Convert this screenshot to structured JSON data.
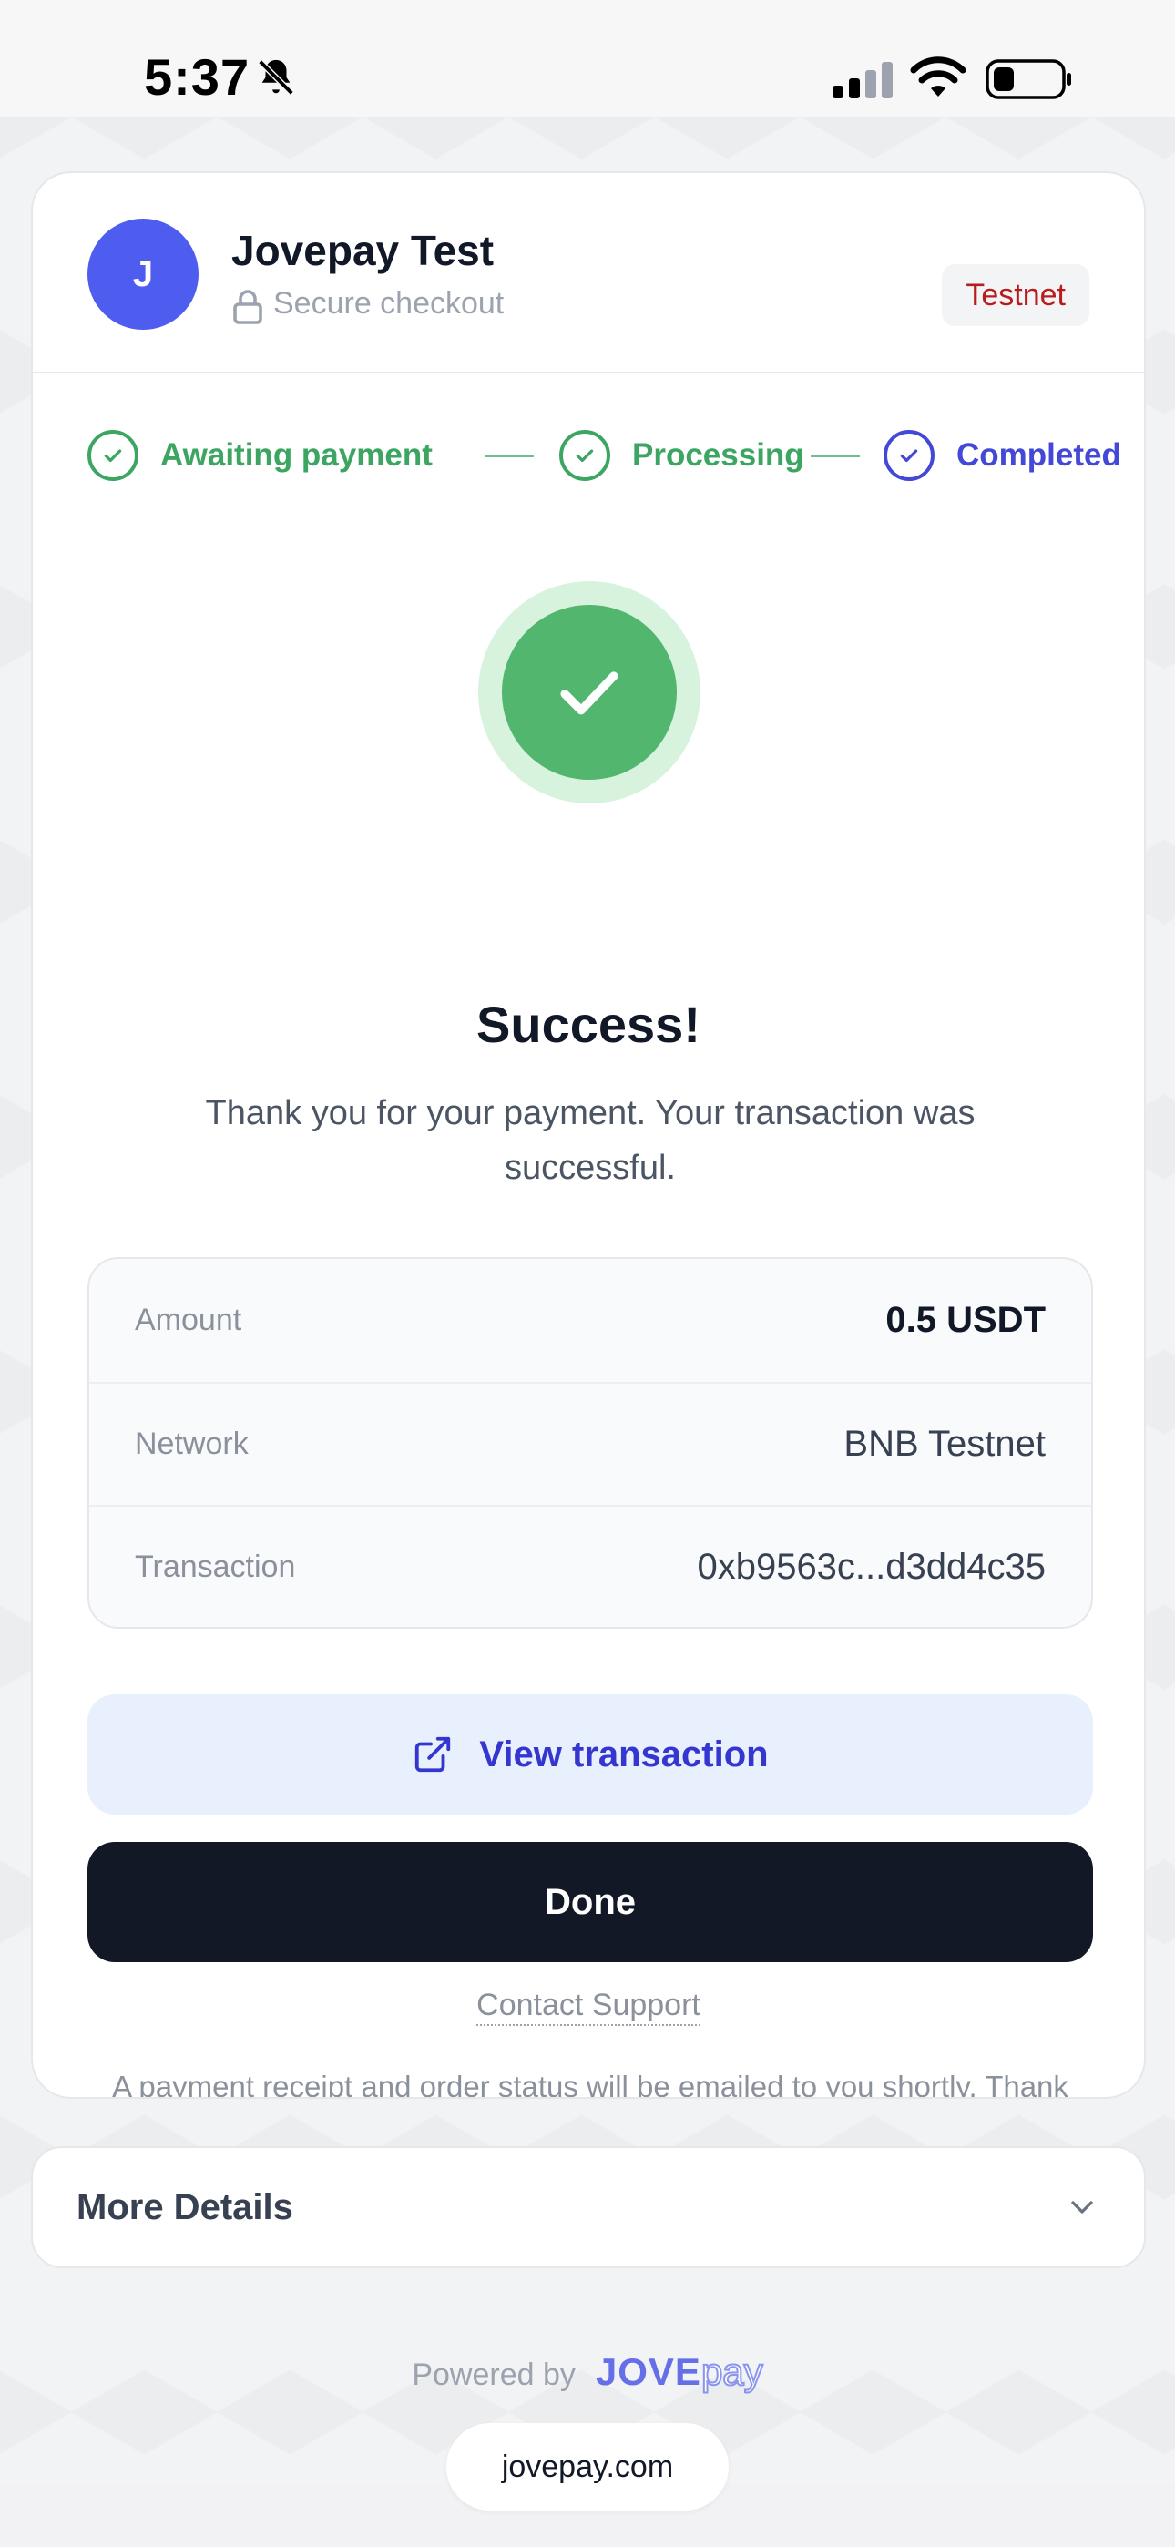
{
  "status_bar": {
    "time": "5:37"
  },
  "merchant": {
    "initial": "J",
    "name": "Jovepay Test",
    "secure_text": "Secure checkout",
    "badge": "Testnet"
  },
  "steps": [
    {
      "label": "Awaiting payment",
      "state": "done"
    },
    {
      "label": "Processing",
      "state": "done"
    },
    {
      "label": "Completed",
      "state": "current"
    }
  ],
  "result": {
    "title": "Success!",
    "message": "Thank you for your payment. Your transaction was successful."
  },
  "details": [
    {
      "label": "Amount",
      "value": "0.5 USDT"
    },
    {
      "label": "Network",
      "value": "BNB Testnet"
    },
    {
      "label": "Transaction",
      "value": "0xb9563c...d3dd4c35"
    }
  ],
  "actions": {
    "view_transaction": "View transaction",
    "done": "Done",
    "contact_support": "Contact Support"
  },
  "receipt_note": "A payment receipt and order status will be emailed to you shortly. Thank you for your trust!",
  "more_details": "More Details",
  "footer": {
    "powered_by": "Powered by",
    "brand_jove": "JOVE",
    "brand_pay": "pay",
    "url": "jovepay.com"
  },
  "colors": {
    "primary": "#4f5cf0",
    "success": "#3ba561",
    "current_step": "#4448d6",
    "badge_text": "#b91c1c",
    "done_button": "#121826"
  }
}
